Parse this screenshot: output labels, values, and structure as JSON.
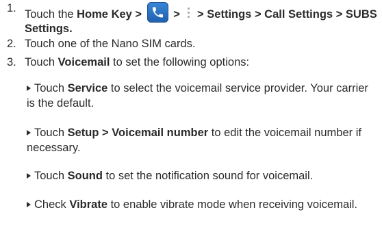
{
  "steps": [
    {
      "num": "1.",
      "prefix": "Touch the ",
      "home_key": "Home Key >",
      "sep1": " > ",
      "tail": " > Settings > Call Settings > SUBS Settings."
    },
    {
      "num": "2.",
      "text": "Touch one of the Nano SIM cards."
    },
    {
      "num": "3.",
      "prefix": "Touch ",
      "bold": "Voicemail",
      "suffix": " to set the following options:"
    }
  ],
  "options": [
    {
      "prefix": "Touch ",
      "bold": "Service",
      "suffix": " to select the voicemail service provider. Your carrier is the default."
    },
    {
      "prefix": "Touch ",
      "bold": "Setup > Voicemail number",
      "suffix": " to edit the voicemail number if necessary."
    },
    {
      "prefix": "Touch ",
      "bold": "Sound",
      "suffix": " to set the notification sound for voicemail."
    },
    {
      "prefix": "Check ",
      "bold": "Vibrate",
      "suffix": " to enable vibrate mode when receiving voicemail."
    }
  ],
  "icons": {
    "phone": "phone-app-icon",
    "more": "menu-more-icon",
    "bullet": "triangle-bullet-icon"
  },
  "colors": {
    "text": "#2a2a2a",
    "phone_icon_bg": "#2a6fc0"
  }
}
